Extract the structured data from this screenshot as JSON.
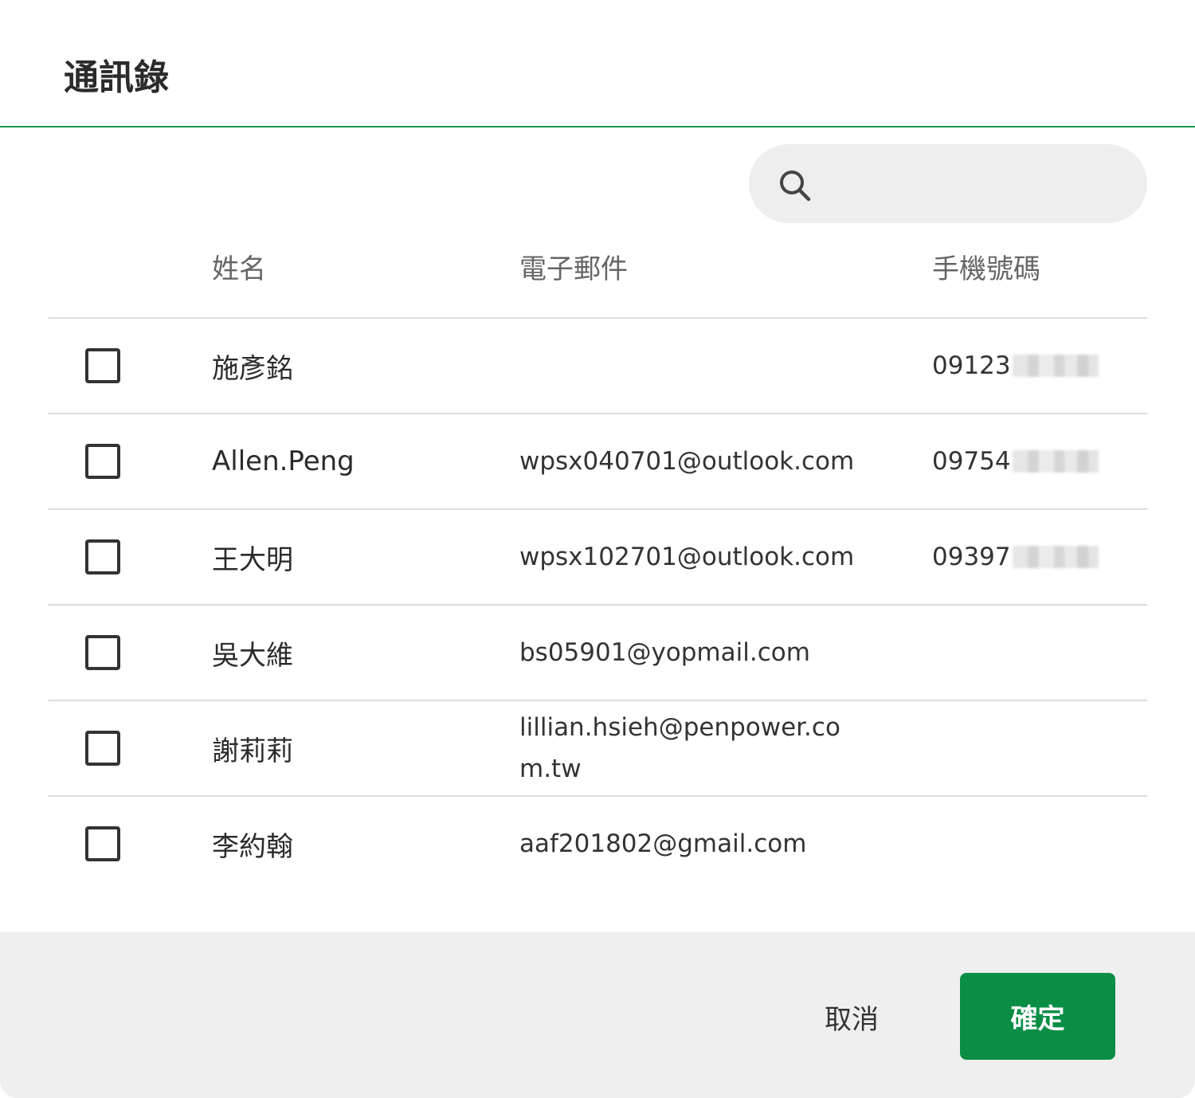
{
  "dialog": {
    "title": "通訊錄"
  },
  "search": {
    "placeholder": "",
    "value": "",
    "icon": "search-icon"
  },
  "table": {
    "headers": {
      "name": "姓名",
      "email": "電子郵件",
      "phone": "手機號碼"
    },
    "rows": [
      {
        "checked": false,
        "name": "施彥銘",
        "email": "",
        "phone": "09123"
      },
      {
        "checked": false,
        "name": "Allen.Peng",
        "email": "wpsx040701@outlook.com",
        "phone": "09754"
      },
      {
        "checked": false,
        "name": "王大明",
        "email": "wpsx102701@outlook.com",
        "phone": "09397"
      },
      {
        "checked": false,
        "name": "吳大維",
        "email": "bs05901@yopmail.com",
        "phone": ""
      },
      {
        "checked": false,
        "name": "謝莉莉",
        "email": "lillian.hsieh@penpower.com.tw",
        "phone": ""
      },
      {
        "checked": false,
        "name": "李約翰",
        "email": "aaf201802@gmail.com",
        "phone": ""
      }
    ]
  },
  "footer": {
    "cancel_label": "取消",
    "confirm_label": "確定"
  },
  "colors": {
    "accent": "#0a8e46",
    "header_rule": "#1e9a4f",
    "footer_bg": "#efefef",
    "search_bg": "#eeeeee"
  }
}
